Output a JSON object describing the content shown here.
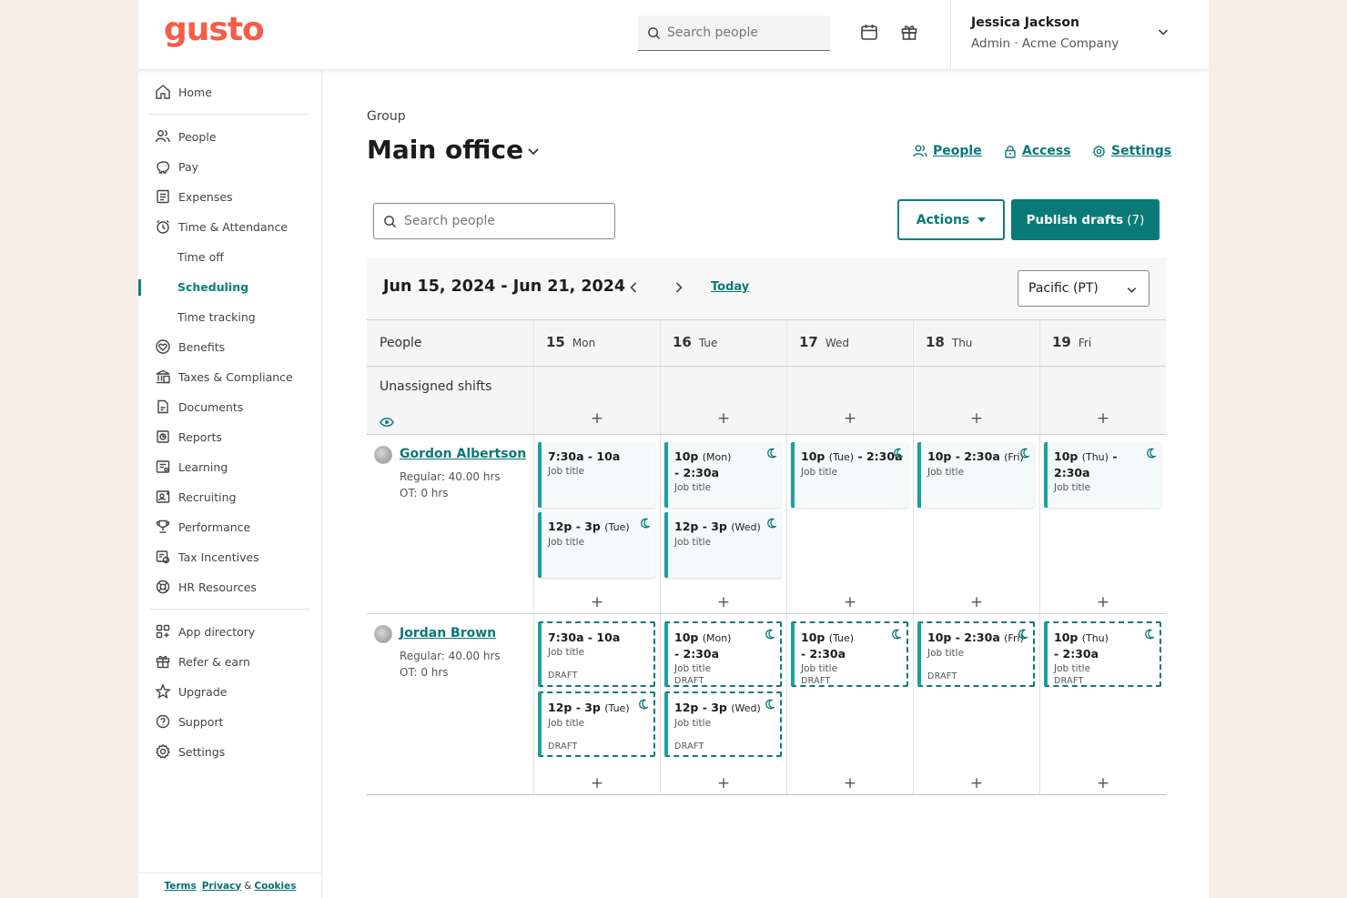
{
  "topbar": {
    "logo": "gusto",
    "search_placeholder": "Search people",
    "user_name": "Jessica Jackson",
    "user_role": "Admin · Acme Company"
  },
  "sidebar": {
    "items": [
      {
        "label": "Home",
        "icon": "home-icon"
      },
      {
        "label": "People",
        "icon": "people-icon"
      },
      {
        "label": "Pay",
        "icon": "piggy-bank-icon"
      },
      {
        "label": "Expenses",
        "icon": "receipt-icon"
      },
      {
        "label": "Time & Attendance",
        "icon": "clock-icon"
      },
      {
        "label": "Time off",
        "sub": true
      },
      {
        "label": "Scheduling",
        "sub": true,
        "active": true
      },
      {
        "label": "Time tracking",
        "sub": true
      },
      {
        "label": "Benefits",
        "icon": "heart-icon"
      },
      {
        "label": "Taxes & Compliance",
        "icon": "bank-icon"
      },
      {
        "label": "Documents",
        "icon": "documents-icon"
      },
      {
        "label": "Reports",
        "icon": "reports-icon"
      },
      {
        "label": "Learning",
        "icon": "learning-icon"
      },
      {
        "label": "Recruiting",
        "icon": "recruiting-icon"
      },
      {
        "label": "Performance",
        "icon": "trophy-icon"
      },
      {
        "label": "Tax Incentives",
        "icon": "tax-incentives-icon"
      },
      {
        "label": "HR Resources",
        "icon": "lifebuoy-icon"
      },
      {
        "label": "App directory",
        "icon": "apps-icon"
      },
      {
        "label": "Refer & earn",
        "icon": "gift-icon"
      },
      {
        "label": "Upgrade",
        "icon": "star-icon"
      },
      {
        "label": "Support",
        "icon": "help-icon"
      },
      {
        "label": "Settings",
        "icon": "gear-icon"
      }
    ],
    "footer": {
      "terms": "Terms",
      "privacy": "Privacy",
      "amp": "&",
      "cookies": "Cookies"
    }
  },
  "main": {
    "group_label": "Group",
    "group_title": "Main office",
    "links": {
      "people": "People",
      "access": "Access",
      "settings": "Settings"
    },
    "search_placeholder": "Search people",
    "actions_label": "Actions",
    "publish_label": "Publish drafts",
    "publish_count": "(7)"
  },
  "calendar": {
    "date_range": "Jun 15, 2024 - Jun 21, 2024",
    "today": "Today",
    "timezone": "Pacific (PT)",
    "people_header": "People",
    "days": [
      {
        "num": "15",
        "name": "Mon"
      },
      {
        "num": "16",
        "name": "Tue"
      },
      {
        "num": "17",
        "name": "Wed"
      },
      {
        "num": "18",
        "name": "Thu"
      },
      {
        "num": "19",
        "name": "Fri"
      }
    ],
    "unassigned_label": "Unassigned shifts",
    "people": [
      {
        "name": "Gordon Albertson",
        "regular": "Regular: 40.00 hrs",
        "ot": "OT: 0 hrs",
        "shifts": [
          [
            {
              "time": "7:30a - 10a",
              "job": "Job title"
            },
            {
              "time": "12p - 3p",
              "day": "(Tue)",
              "job": "Job title",
              "night": true
            }
          ],
          [
            {
              "time": "10p",
              "day": "(Mon)",
              "time2": "- 2:30a",
              "job": "Job title",
              "night": true
            },
            {
              "time": "12p - 3p",
              "day": "(Wed)",
              "job": "Job title",
              "night": true
            }
          ],
          [
            {
              "time": "10p",
              "day": "(Tue)",
              "time2": "- 2:30a",
              "job": "Job title",
              "night": true,
              "oneline": true
            }
          ],
          [
            {
              "time": "10p - 2:30a",
              "day": "(Fri)",
              "job": "Job title",
              "night": true,
              "oneline": true
            }
          ],
          [
            {
              "time": "10p",
              "day": "(Thu)",
              "time2": "- 2:30a",
              "job": "Job title",
              "night": true,
              "oneline": true
            }
          ]
        ]
      },
      {
        "name": "Jordan Brown",
        "regular": "Regular: 40.00 hrs",
        "ot": "OT: 0 hrs",
        "shifts": [
          [
            {
              "time": "7:30a - 10a",
              "job": "Job title",
              "draft": "DRAFT"
            },
            {
              "time": "12p - 3p",
              "day": "(Tue)",
              "job": "Job title",
              "night": true,
              "draft": "DRAFT"
            }
          ],
          [
            {
              "time": "10p",
              "day": "(Mon)",
              "time2": "- 2:30a",
              "job": "Job title",
              "night": true,
              "draft": "DRAFT"
            },
            {
              "time": "12p - 3p",
              "day": "(Wed)",
              "job": "Job title",
              "night": true,
              "draft": "DRAFT"
            }
          ],
          [
            {
              "time": "10p",
              "day": "(Tue)",
              "time2": "- 2:30a",
              "job": "Job title",
              "night": true,
              "draft": "DRAFT"
            }
          ],
          [
            {
              "time": "10p - 2:30a",
              "day": "(Fri)",
              "job": "Job title",
              "night": true,
              "draft": "DRAFT",
              "oneline": true
            }
          ],
          [
            {
              "time": "10p",
              "day": "(Thu)",
              "time2": "- 2:30a",
              "job": "Job title",
              "night": true,
              "draft": "DRAFT"
            }
          ]
        ]
      }
    ]
  },
  "colors": {
    "accent": "#0a7a78",
    "brand": "#f45d48",
    "shift_border": "#1aa19d"
  }
}
